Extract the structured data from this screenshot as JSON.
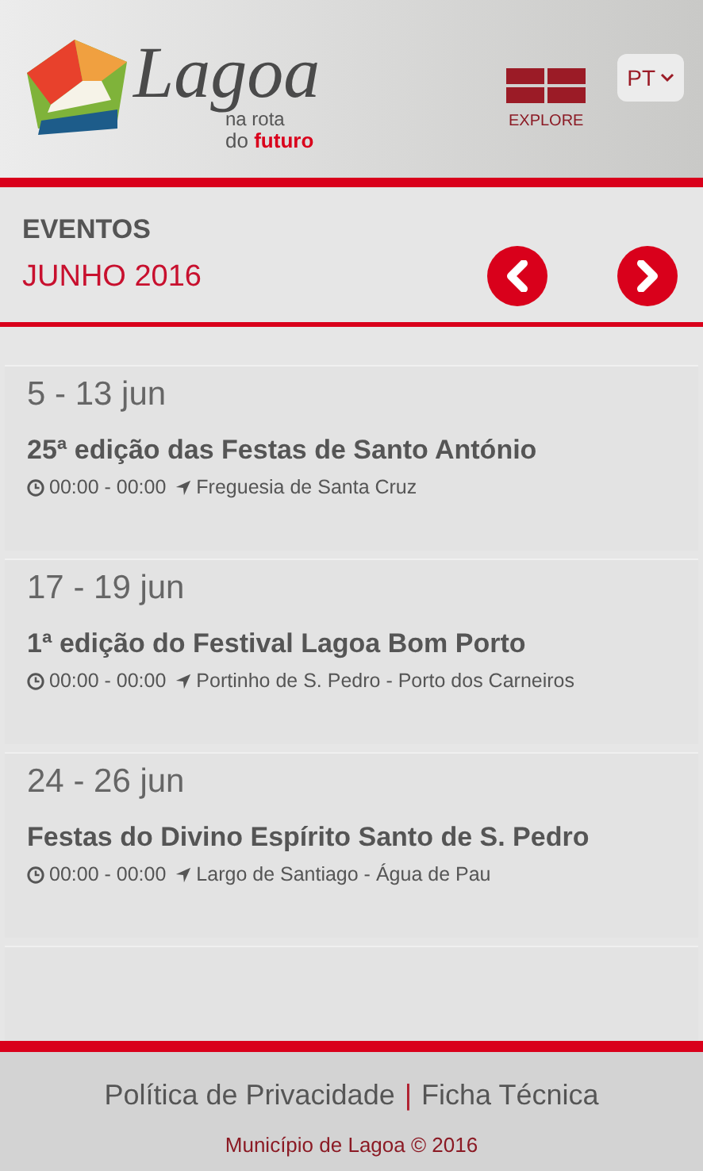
{
  "header": {
    "logo_title": "Lagoa",
    "logo_tagline_1": "na rota",
    "logo_tagline_2_prefix": "do",
    "logo_tagline_2_highlight": "futuro",
    "explore_label": "EXPLORE",
    "language": "PT"
  },
  "events_header": {
    "title": "EVENTOS",
    "month": "JUNHO 2016"
  },
  "events": [
    {
      "dates": "5 - 13 jun",
      "title": "25ª edição das Festas de Santo António",
      "time": "00:00 - 00:00",
      "location": "Freguesia de Santa Cruz"
    },
    {
      "dates": "17 - 19 jun",
      "title": "1ª edição do Festival Lagoa Bom Porto",
      "time": "00:00 - 00:00",
      "location": "Portinho de S. Pedro - Porto dos Carneiros"
    },
    {
      "dates": "24 - 26 jun",
      "title": "Festas do Divino Espírito Santo de S. Pedro",
      "time": "00:00 - 00:00",
      "location": "Largo de Santiago - Água de Pau"
    }
  ],
  "footer": {
    "links": [
      "Política de Privacidade",
      "Ficha Técnica"
    ],
    "separator": "|",
    "copyright": "Município de Lagoa © 2016"
  }
}
